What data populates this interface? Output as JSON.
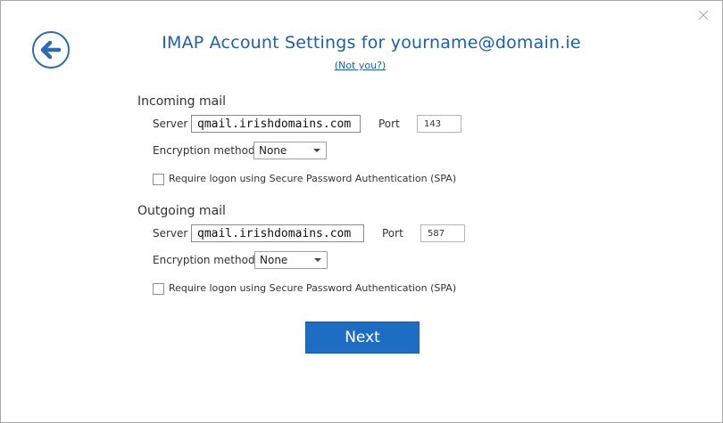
{
  "dialog": {
    "title": "IMAP Account Settings for yourname@domain.ie",
    "not_you_link": "(Not you?)",
    "next_label": "Next"
  },
  "incoming": {
    "heading": "Incoming mail",
    "server_label": "Server",
    "server_value": "qmail.irishdomains.com",
    "port_label": "Port",
    "port_value": "143",
    "encryption_label": "Encryption method",
    "encryption_value": "None",
    "spa_label": "Require logon using Secure Password Authentication (SPA)",
    "spa_checked": false
  },
  "outgoing": {
    "heading": "Outgoing mail",
    "server_label": "Server",
    "server_value": "qmail.irishdomains.com",
    "port_label": "Port",
    "port_value": "587",
    "encryption_label": "Encryption method",
    "encryption_value": "None",
    "spa_label": "Require logon using Secure Password Authentication (SPA)",
    "spa_checked": false
  },
  "icons": {
    "back": "back-arrow-icon",
    "close": "close-icon",
    "dropdown": "chevron-down-icon"
  },
  "colors": {
    "accent": "#1f5fa8",
    "button": "#1f6dc2"
  }
}
